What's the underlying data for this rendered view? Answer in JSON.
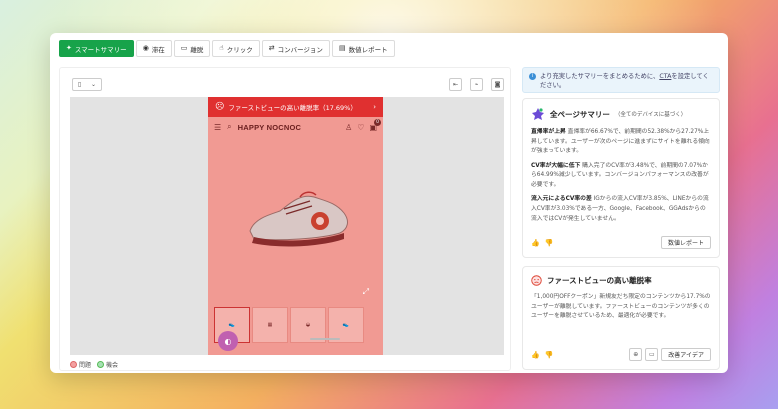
{
  "tabs": [
    {
      "label": "スマートサマリー",
      "icon": "sparkle-icon"
    },
    {
      "label": "滞在",
      "icon": "eye-icon"
    },
    {
      "label": "離脱",
      "icon": "window-icon"
    },
    {
      "label": "クリック",
      "icon": "pointer-icon"
    },
    {
      "label": "コンバージョン",
      "icon": "conversion-icon"
    },
    {
      "label": "数値レポート",
      "icon": "table-icon"
    }
  ],
  "preview": {
    "device": "mobile",
    "banner": "ファーストビューの高い離脱率（17.69%）",
    "brand": "HAPPY NOCNOC",
    "cart_count": "0",
    "accent_overlay": "#f19a93"
  },
  "legend": {
    "bad": "問題",
    "good": "機会"
  },
  "info": {
    "text_before": "より充実したサマリーをまとめるために、",
    "link": "CTA",
    "text_after": "を設定してください。"
  },
  "summary_card": {
    "title": "全ページサマリー",
    "subtitle": "（全てのデバイスに基づく）",
    "items": [
      {
        "lead": "直帰率が上昇",
        "text": "直帰率が66.67%で、前期間の52.38%から27.27%上昇しています。ユーザーが次のページに進まずにサイトを離れる傾向が強まっています。"
      },
      {
        "lead": "CV率が大幅に低下",
        "text": "購入完了のCV率が3.48%で、前期間の7.07%から64.99%減少しています。コンバージョンパフォーマンスの改善が必要です。"
      },
      {
        "lead": "流入元によるCV率の差",
        "text": "IGからの流入CV率が3.85%、LINEからの流入CV率が3.03%である一方、Google、Facebook、GGAdsからの流入ではCVが発生していません。"
      }
    ],
    "button": "数値レポート"
  },
  "issue_card": {
    "title": "ファーストビューの高い離脱率",
    "text": "「1,000円OFFクーポン」新規友だち限定のコンテンツから17.7%のユーザーが離脱しています。ファーストビューのコンテンツが多くのユーザーを離脱させているため、最適化が必要です。",
    "button": "改善アイデア"
  },
  "colors": {
    "brand_green": "#17a34a",
    "alert_red": "#e03030"
  }
}
